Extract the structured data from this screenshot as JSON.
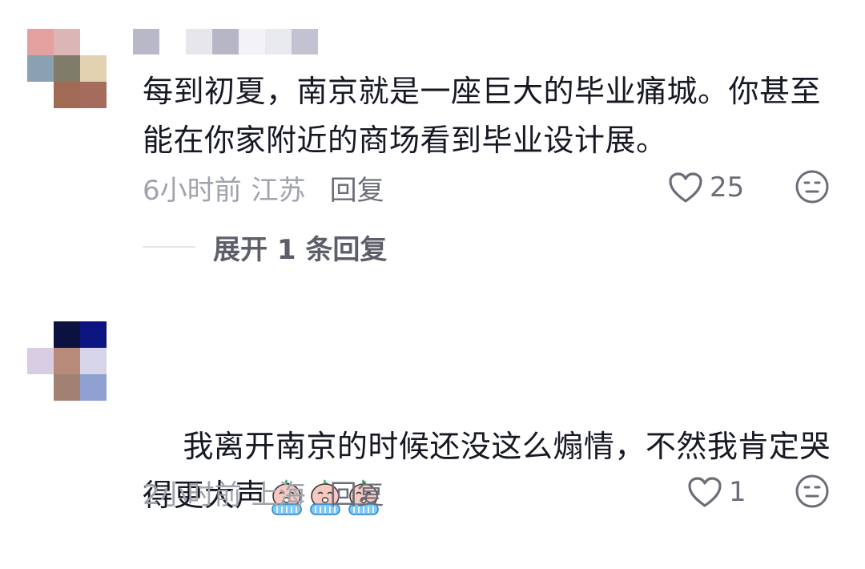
{
  "comments": [
    {
      "text": "每到初夏，南京就是一座巨大的毕业痛城。你甚至能在你家附近的商场看到毕业设计展。",
      "time": "6小时前",
      "location": "江苏",
      "reply_label": "回复",
      "likes": "25",
      "expand_replies_label": "展开 1 条回复",
      "avatar_colors": [
        "#e3a09f",
        "#dcb6b6",
        "#ffffff",
        "#8aa0b3",
        "#7f7c6a",
        "#e2d2b2",
        "#ffffff",
        "#a06a55",
        "#a56b5c"
      ]
    },
    {
      "text": "我离开南京的时候还没这么煽情，不然我肯定哭得更大声",
      "time": "2小时前",
      "location": "上海",
      "reply_label": "回复",
      "likes": "1",
      "emoji": [
        "crying-emoji",
        "crying-emoji",
        "crying-emoji"
      ],
      "avatar_colors": [
        "#ffffff",
        "#0b1240",
        "#0c1480",
        "#d8cde3",
        "#b88a7a",
        "#d6d4e8",
        "#ffffff",
        "#a18272",
        "#8ea0cf"
      ]
    }
  ],
  "username_mosaic_colors": [
    "#b9b8c8",
    "#ffffff",
    "#e6e6ec",
    "#b7b6c7",
    "#f2f2f7",
    "#e9e9f0",
    "#c3c2d2"
  ],
  "colors": {
    "text": "#161823",
    "meta": "#a0a3ab",
    "action": "#6b6e78"
  }
}
